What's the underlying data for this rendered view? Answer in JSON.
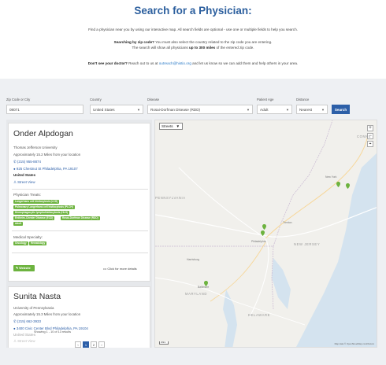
{
  "hero": {
    "title": "Search for a Physician:",
    "line1": "Find a physician near you by using our interactive map. All search fields are optional - use one or multiple fields to help you search.",
    "zip_bold": "Searching by zip code?",
    "zip_rest": " You must also select the country related to the zip code you are entering.",
    "line3_pre": "The search will show all physicians ",
    "line3_bold": "up to 300 miles",
    "line3_post": " of the entered zip code.",
    "doctor_bold": "Don't see your doctor?",
    "doctor_pre": " Reach out to us at ",
    "doctor_email": "outreach@histio.org",
    "doctor_post": " and let us know so we can add them and help others in your area."
  },
  "search": {
    "zip_label": "Zip Code or City",
    "zip_value": "08071",
    "country_label": "Country",
    "country_value": "United States",
    "disease_label": "Disease",
    "disease_value": "Rosai-Dorfman Disease (RDD)",
    "age_label": "Patient Age",
    "age_value": "Adult",
    "distance_label": "Distance",
    "distance_value": "Nearest",
    "button": "Search"
  },
  "results": [
    {
      "name": "Onder Alpdogan",
      "institution": "Thomas Jefferson University",
      "distance": "Approximately 15.2 Miles from your location",
      "phone": "(215) 955-8874",
      "address": "925 Chestnut St Philadelphia, PA 19107",
      "country": "United States",
      "street_view": "Street View",
      "treats_label": "Physician Treats:",
      "treats": [
        "Langerhans cell histiocytosis (LCH)",
        "Pulmonary Langerhans cell histiocytosis (PLCH)",
        "Hemophagocytic lymphohistiocytosis (HLH)",
        "Erdheim-Chester Disease (ECD)",
        "Rosai-Dorfman Disease (RDD)",
        "Adult"
      ],
      "specialty_label": "Medical Specialty:",
      "specialties": [
        "Oncology",
        "Hematology"
      ],
      "website": "Website",
      "more": "Click for more details"
    },
    {
      "name": "Sunita Nasta",
      "institution": "University of Pennsylvania",
      "distance": "Approximately 15.3 Miles from your location",
      "phone": "(215) 662-3933",
      "address": "3400 Civic Center Blvd Philadelphia, PA 19104",
      "country": "United States",
      "street_view": "Street View"
    }
  ],
  "pagination": {
    "showing": "Showing 1 - 10 of 13 results",
    "prev": "‹",
    "page1": "1",
    "page2": "2",
    "next": "›"
  },
  "map": {
    "layer_select": "Streets",
    "zoom_in": "+",
    "zoom_out": "−",
    "labels": {
      "pennsylvania": "PENNSYLVANIA",
      "new_jersey": "NEW JERSEY",
      "maryland": "MARYLAND",
      "delaware": "DELAWARE",
      "connecticut": "CONNE"
    },
    "cities": {
      "harrisburg": "Harrisburg",
      "philadelphia": "Philadelphia",
      "baltimore": "Baltimore",
      "trenton": "Trenton",
      "new_york": "New York"
    },
    "scale": "20km",
    "attribution": "Map data © OpenStreetMap contributors",
    "colors": {
      "water": "#d4e3ef",
      "land": "#f1f0ec",
      "pin": "#6db33f",
      "road": "#ffffff"
    }
  }
}
